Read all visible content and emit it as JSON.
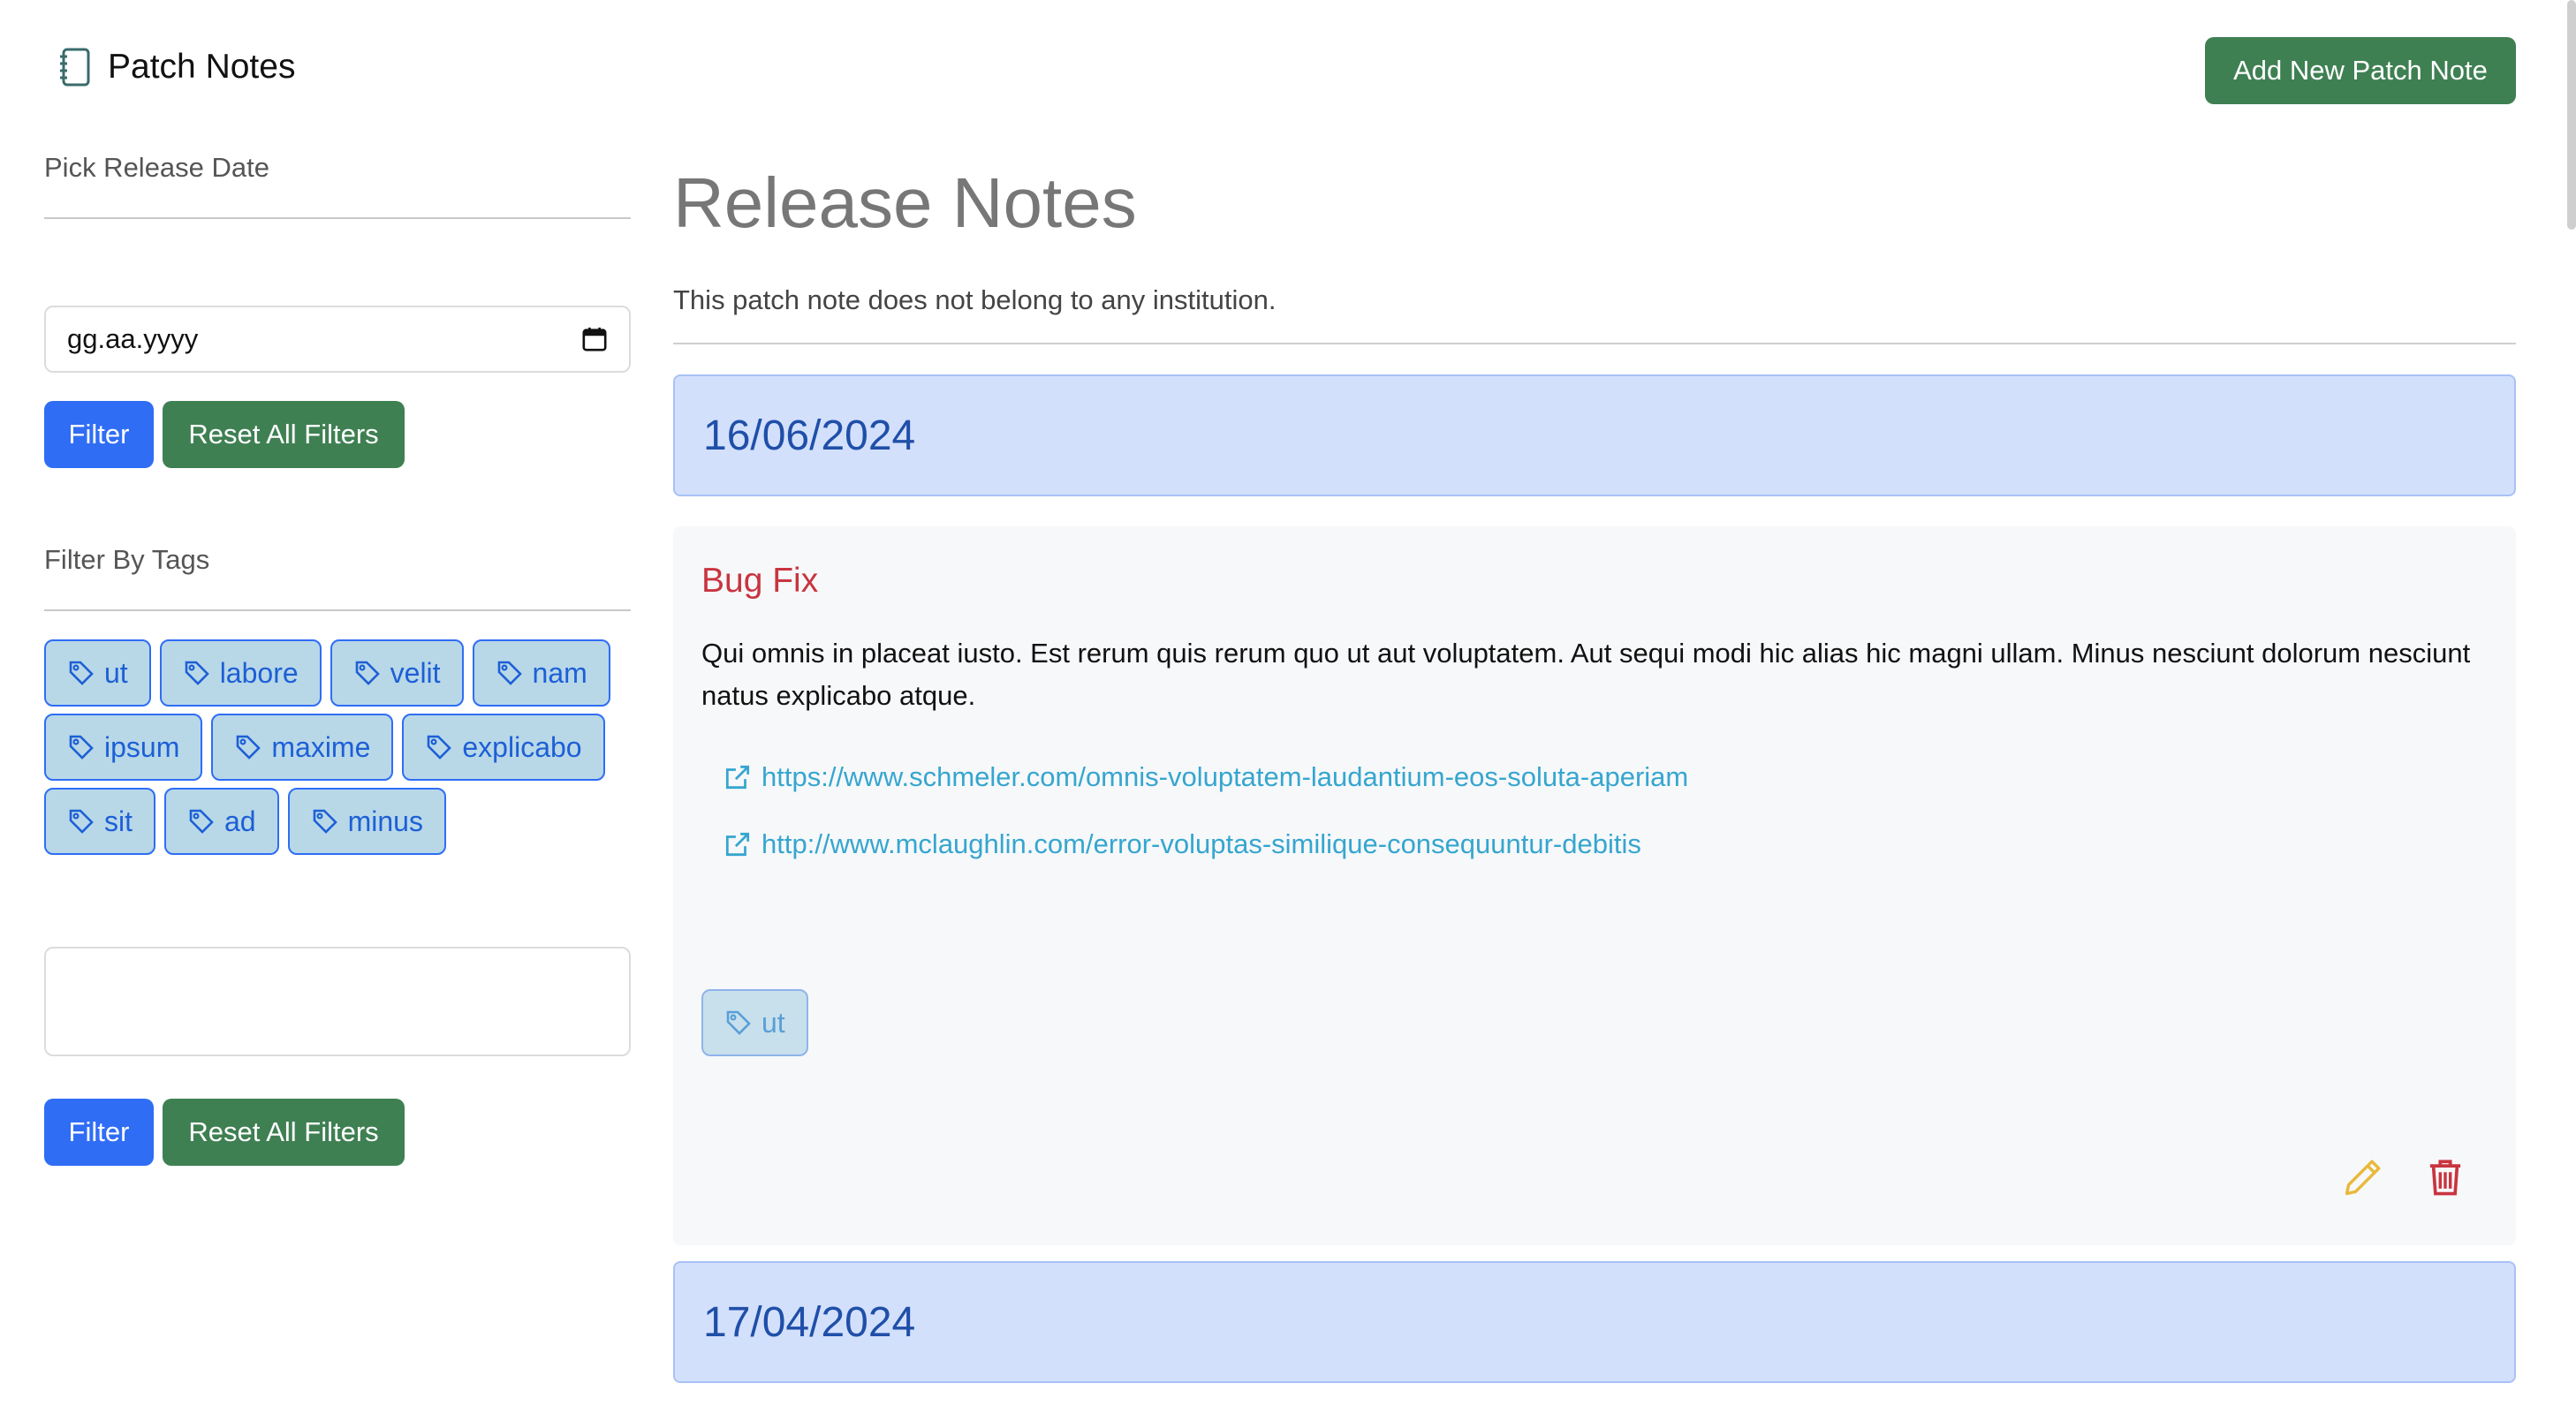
{
  "header": {
    "title": "Patch Notes",
    "add_button": "Add New Patch Note"
  },
  "sidebar": {
    "date_heading": "Pick Release Date",
    "date_input_value": "gg.aa.yyyy",
    "filter_button": "Filter",
    "reset_button": "Reset All Filters",
    "tags_heading": "Filter By Tags",
    "tags": [
      "ut",
      "labore",
      "velit",
      "nam",
      "ipsum",
      "maxime",
      "explicabo",
      "sit",
      "ad",
      "minus"
    ],
    "filter_button_2": "Filter",
    "reset_button_2": "Reset All Filters"
  },
  "main": {
    "title": "Release Notes",
    "subtitle": "This patch note does not belong to any institution.",
    "releases": [
      {
        "date": "16/06/2024",
        "note": {
          "type": "Bug Fix",
          "body": "Qui omnis in placeat iusto. Est rerum quis rerum quo ut aut voluptatem. Aut sequi modi hic alias hic magni ullam. Minus nesciunt dolorum nesciunt natus explicabo atque.",
          "links": [
            "https://www.schmeler.com/omnis-voluptatem-laudantium-eos-soluta-aperiam",
            "http://www.mclaughlin.com/error-voluptas-similique-consequuntur-debitis"
          ],
          "tag": "ut"
        }
      },
      {
        "date": "17/04/2024"
      }
    ]
  },
  "icons": {
    "brand": "notebook-icon",
    "calendar": "calendar-icon",
    "tag": "tag-icon",
    "external_link": "external-link-icon",
    "edit": "pencil-icon",
    "delete": "trash-icon"
  },
  "colors": {
    "primary": "#2f6df5",
    "success": "#3f8053",
    "danger": "#c8353f",
    "warning": "#e8b93a",
    "link": "#35a6cf",
    "release_banner": "#d3e0fc"
  }
}
